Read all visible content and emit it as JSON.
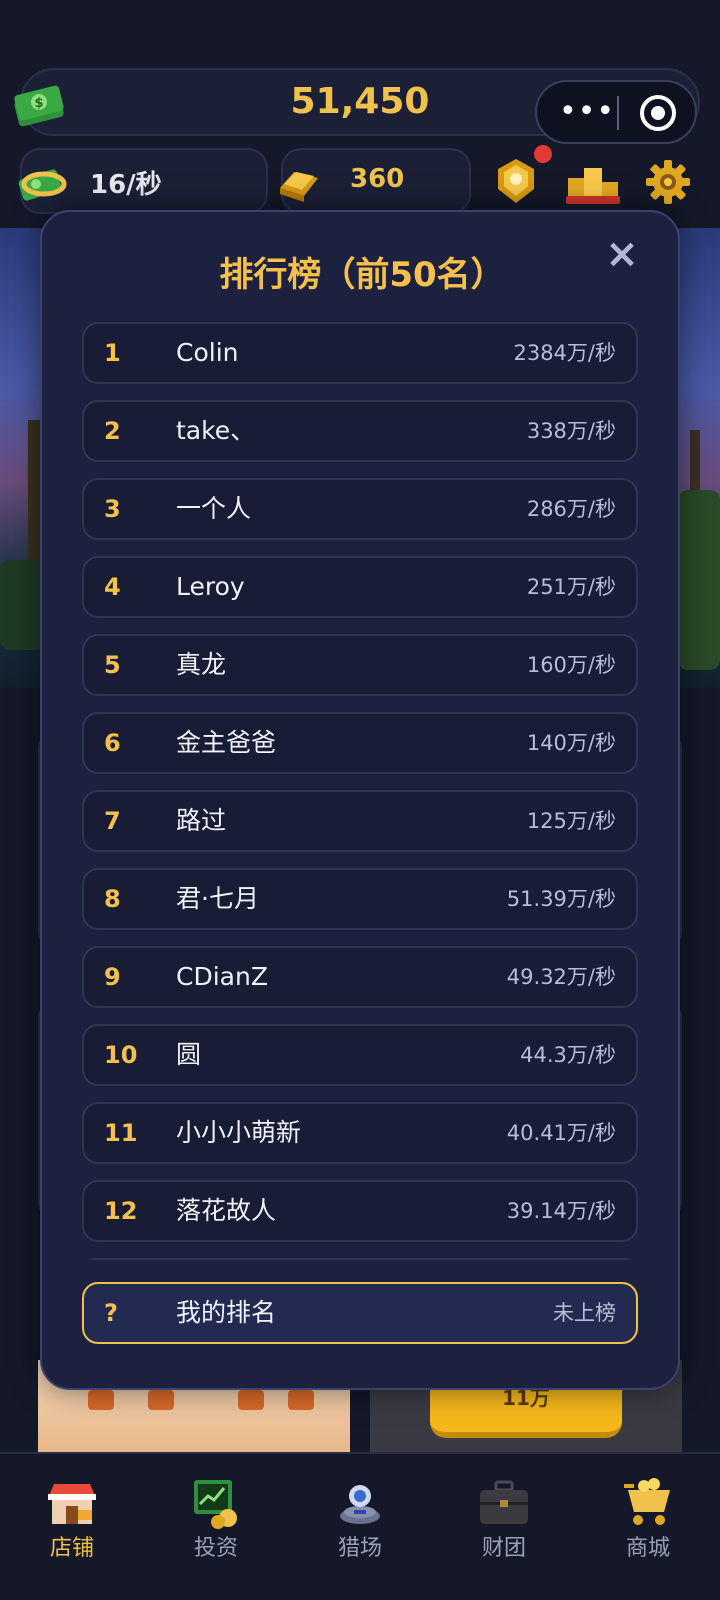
{
  "header": {
    "money": "51,450",
    "income_rate": "16/秒",
    "gold": "360"
  },
  "capsule": {
    "more_icon": "more-dots-icon",
    "close_icon": "target-icon"
  },
  "top_icons": [
    "trophy-badge-icon",
    "podium-icon",
    "gear-icon"
  ],
  "leaderboard": {
    "title": "排行榜（前50名）",
    "close_symbol": "×",
    "entries": [
      {
        "rank": "1",
        "name": "Colin",
        "score": "2384万/秒"
      },
      {
        "rank": "2",
        "name": "take、",
        "score": "338万/秒"
      },
      {
        "rank": "3",
        "name": "一个人",
        "score": "286万/秒"
      },
      {
        "rank": "4",
        "name": "Leroy",
        "score": "251万/秒"
      },
      {
        "rank": "5",
        "name": "真龙",
        "score": "160万/秒"
      },
      {
        "rank": "6",
        "name": "金主爸爸",
        "score": "140万/秒"
      },
      {
        "rank": "7",
        "name": "路过",
        "score": "125万/秒"
      },
      {
        "rank": "8",
        "name": "君·七月",
        "score": "51.39万/秒"
      },
      {
        "rank": "9",
        "name": "CDianZ",
        "score": "49.32万/秒"
      },
      {
        "rank": "10",
        "name": "圆",
        "score": "44.3万/秒"
      },
      {
        "rank": "11",
        "name": "小小小萌新",
        "score": "40.41万/秒"
      },
      {
        "rank": "12",
        "name": "落花故人",
        "score": "39.14万/秒"
      }
    ],
    "my_rank": {
      "rank": "?",
      "name": "我的排名",
      "score": "未上榜"
    }
  },
  "background": {
    "upgrade_cost": "11万"
  },
  "bottom_nav": {
    "items": [
      {
        "label": "店铺",
        "icon": "shop-icon",
        "active": true
      },
      {
        "label": "投资",
        "icon": "investment-icon",
        "active": false
      },
      {
        "label": "猎场",
        "icon": "hunting-ground-icon",
        "active": false
      },
      {
        "label": "财团",
        "icon": "briefcase-icon",
        "active": false
      },
      {
        "label": "商城",
        "icon": "shopping-cart-icon",
        "active": false
      }
    ]
  },
  "colors": {
    "accent_gold": "#f0c14b",
    "modal_bg": "#1c2140",
    "page_bg": "#141828"
  }
}
